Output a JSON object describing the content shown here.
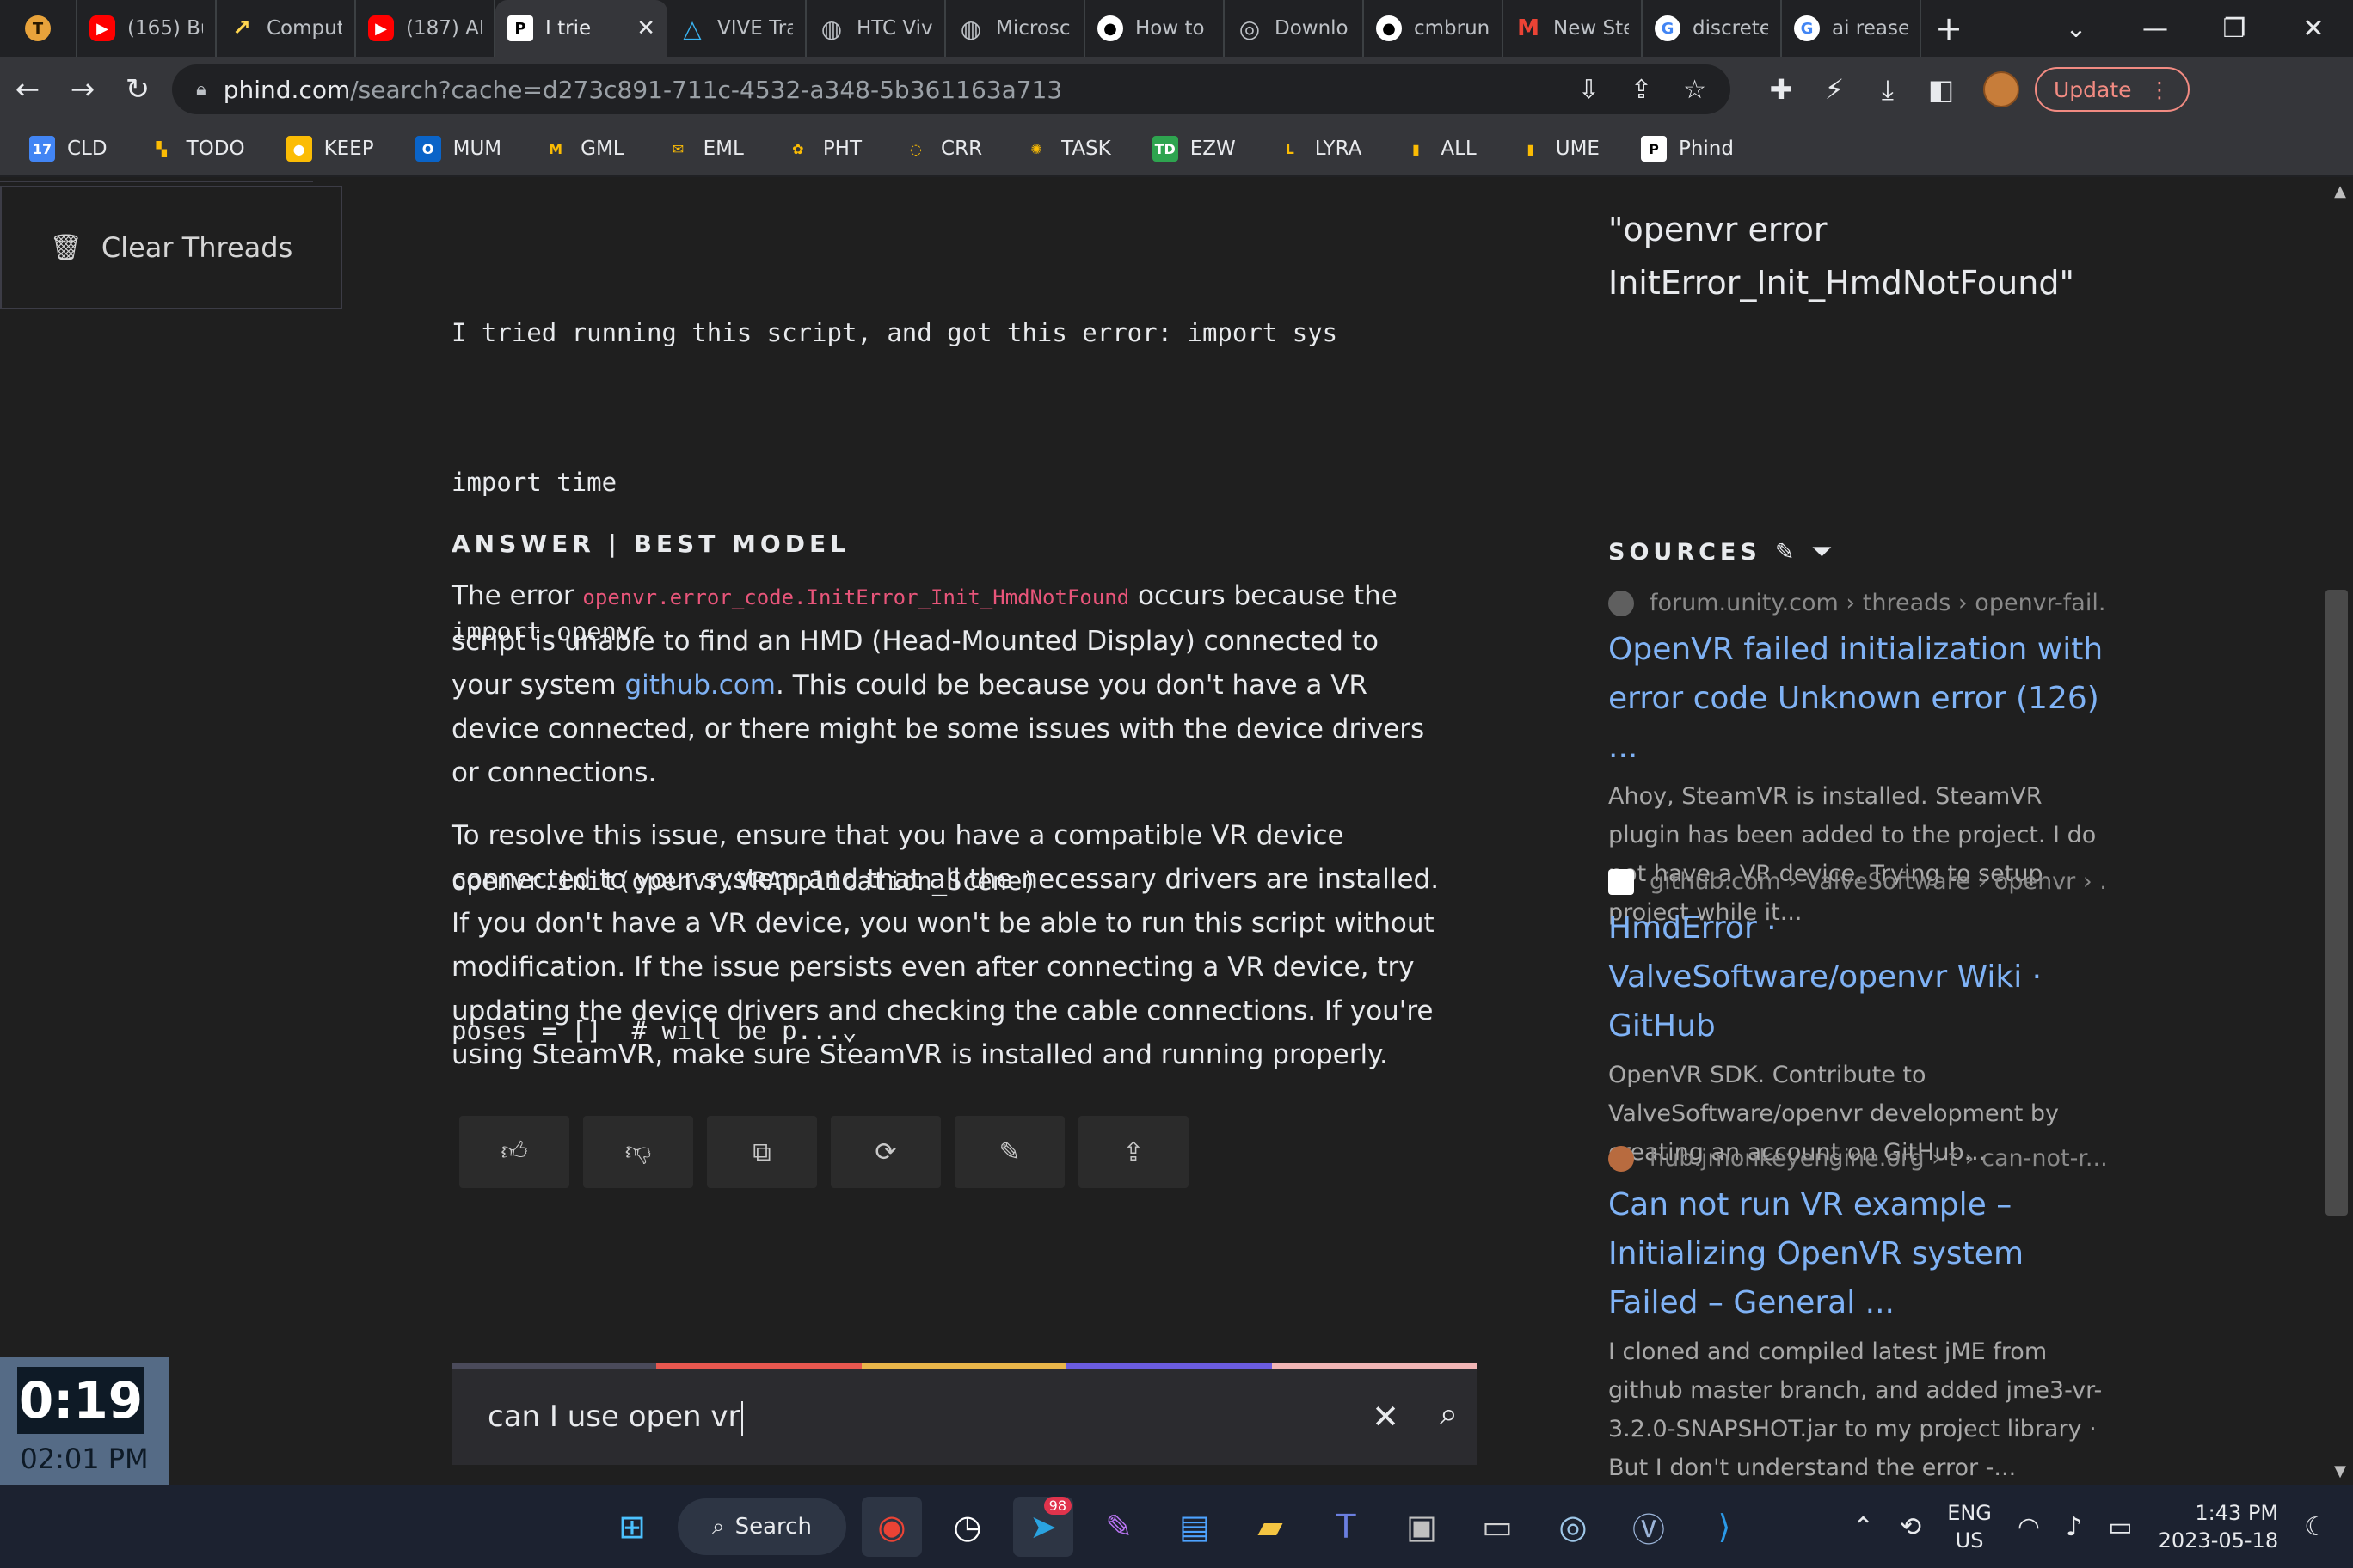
{
  "tabs": [
    {
      "label": "",
      "icon": "t-icon",
      "glyph": "T",
      "cls": "t"
    },
    {
      "label": "(165) Bu",
      "icon": "youtube-icon",
      "glyph": "▶",
      "cls": "yt"
    },
    {
      "label": "Comput",
      "icon": "arrow-up-right-icon",
      "glyph": "↗",
      "cls": "comp"
    },
    {
      "label": "(187) AI",
      "icon": "youtube-icon",
      "glyph": "▶",
      "cls": "yt"
    },
    {
      "label": "I trie",
      "icon": "phind-icon",
      "glyph": "P",
      "cls": "p",
      "active": true
    },
    {
      "label": "VIVE Tra",
      "icon": "vive-icon",
      "glyph": "△",
      "cls": "vive"
    },
    {
      "label": "HTC Viv",
      "icon": "globe-icon",
      "glyph": "◍",
      "cls": "globe"
    },
    {
      "label": "Microsc",
      "icon": "globe-icon",
      "glyph": "◍",
      "cls": "globe"
    },
    {
      "label": "How to",
      "icon": "github-icon",
      "glyph": "●",
      "cls": "gh"
    },
    {
      "label": "Downlo",
      "icon": "steam-icon",
      "glyph": "◎",
      "cls": "globe"
    },
    {
      "label": "cmbrun",
      "icon": "github-icon",
      "glyph": "●",
      "cls": "gh"
    },
    {
      "label": "New Ste",
      "icon": "gmail-icon",
      "glyph": "M",
      "cls": "gm"
    },
    {
      "label": "discrete",
      "icon": "google-icon",
      "glyph": "G",
      "cls": "g"
    },
    {
      "label": "ai rease",
      "icon": "google-icon",
      "glyph": "G",
      "cls": "g"
    }
  ],
  "address": {
    "host": "phind.com",
    "path": "/search?cache=d273c891-711c-4532-a348-5b361163a713"
  },
  "toolbar": {
    "update_label": "Update"
  },
  "bookmarks": [
    {
      "label": "CLD",
      "icon": "calendar-icon",
      "glyph": "17",
      "bg": "#4285f4"
    },
    {
      "label": "TODO",
      "icon": "todo-icon",
      "glyph": "▚",
      "bg": "transparent"
    },
    {
      "label": "KEEP",
      "icon": "keep-icon",
      "glyph": "●",
      "bg": "#fbbc04"
    },
    {
      "label": "MUM",
      "icon": "outlook-icon",
      "glyph": "O",
      "bg": "#0a64c8"
    },
    {
      "label": "GML",
      "icon": "gmail-icon",
      "glyph": "M",
      "bg": "transparent"
    },
    {
      "label": "EML",
      "icon": "email-icon",
      "glyph": "✉",
      "bg": "transparent"
    },
    {
      "label": "PHT",
      "icon": "photos-icon",
      "glyph": "✿",
      "bg": "transparent"
    },
    {
      "label": "CRR",
      "icon": "crr-icon",
      "glyph": "◌",
      "bg": "transparent"
    },
    {
      "label": "TASK",
      "icon": "task-icon",
      "glyph": "✺",
      "bg": "transparent"
    },
    {
      "label": "EZW",
      "icon": "td-icon",
      "glyph": "TD",
      "bg": "#2ea44f"
    },
    {
      "label": "LYRA",
      "icon": "lyra-icon",
      "glyph": "L",
      "bg": "transparent"
    },
    {
      "label": "ALL",
      "icon": "folder-icon",
      "glyph": "▮",
      "bg": "transparent"
    },
    {
      "label": "UME",
      "icon": "folder-icon",
      "glyph": "▮",
      "bg": "transparent"
    },
    {
      "label": "Phind",
      "icon": "phind-icon",
      "glyph": "P",
      "bg": "#ffffff"
    }
  ],
  "sidebar": {
    "clear_threads": "Clear Threads"
  },
  "query": {
    "lines": [
      "I tried running this script, and got this error: import sys",
      "import time",
      "import openvr",
      "",
      "openvr.init(openvr.VRApplication_Scene)",
      "poses = []  # will be p...⌄"
    ]
  },
  "answer": {
    "heading": "ANSWER | BEST MODEL",
    "p1_a": "The error ",
    "p1_code": "openvr.error_code.InitError_Init_HmdNotFound",
    "p1_b": " occurs because the script is unable to find an HMD (Head-Mounted Display) connected to your system ",
    "p1_link": "github.com",
    "p1_c": ". This could be because you don't have a VR device connected, or there might be some issues with the device drivers or connections.",
    "p2": "To resolve this issue, ensure that you have a compatible VR device connected to your system and that all the necessary drivers are installed. If you don't have a VR device, you won't be able to run this script without modification. If the issue persists even after connecting a VR device, try updating the device drivers and checking the cable connections. If you're using SteamVR, make sure SteamVR is installed and running properly."
  },
  "search": {
    "value": "can I use open vr"
  },
  "gradient_colors": [
    "#4a4a5a",
    "#e8574f",
    "#e9b64a",
    "#6b5ce0",
    "#f1b5b5"
  ],
  "right": {
    "title": "\"openvr error InitError_Init_HmdNotFound\"",
    "sources_heading": "SOURCES",
    "sources": [
      {
        "crumb": "forum.unity.com › threads › openvr-fail...",
        "title": "OpenVR failed initialization with error code Unknown error (126) ...",
        "snippet": "Ahoy, SteamVR is installed. SteamVR plugin has been added to the project. I do not have a VR device. Trying to setup project while it..."
      },
      {
        "crumb": "github.com › ValveSoftware › openvr › ...",
        "title": "HmdError · ValveSoftware/openvr Wiki · GitHub",
        "snippet": "OpenVR SDK. Contribute to ValveSoftware/openvr development by creating an account on GitHub..."
      },
      {
        "crumb": "hub.jmonkeyengine.org › t › can-not-r...",
        "title": "Can not run VR example – Initializing OpenVR system Failed – General ...",
        "snippet": "I cloned and compiled latest jME from github master branch, and added jme3-vr-3.2.0-SNAPSHOT.jar to my project library · But I don't understand the error -..."
      }
    ]
  },
  "timer": {
    "elapsed": "0:19",
    "clock": "02:01 PM"
  },
  "taskbar": {
    "search_label": "Search",
    "telegram_badge": "98",
    "lang_top": "ENG",
    "lang_bottom": "US",
    "time": "1:43 PM",
    "date": "2023-05-18"
  }
}
